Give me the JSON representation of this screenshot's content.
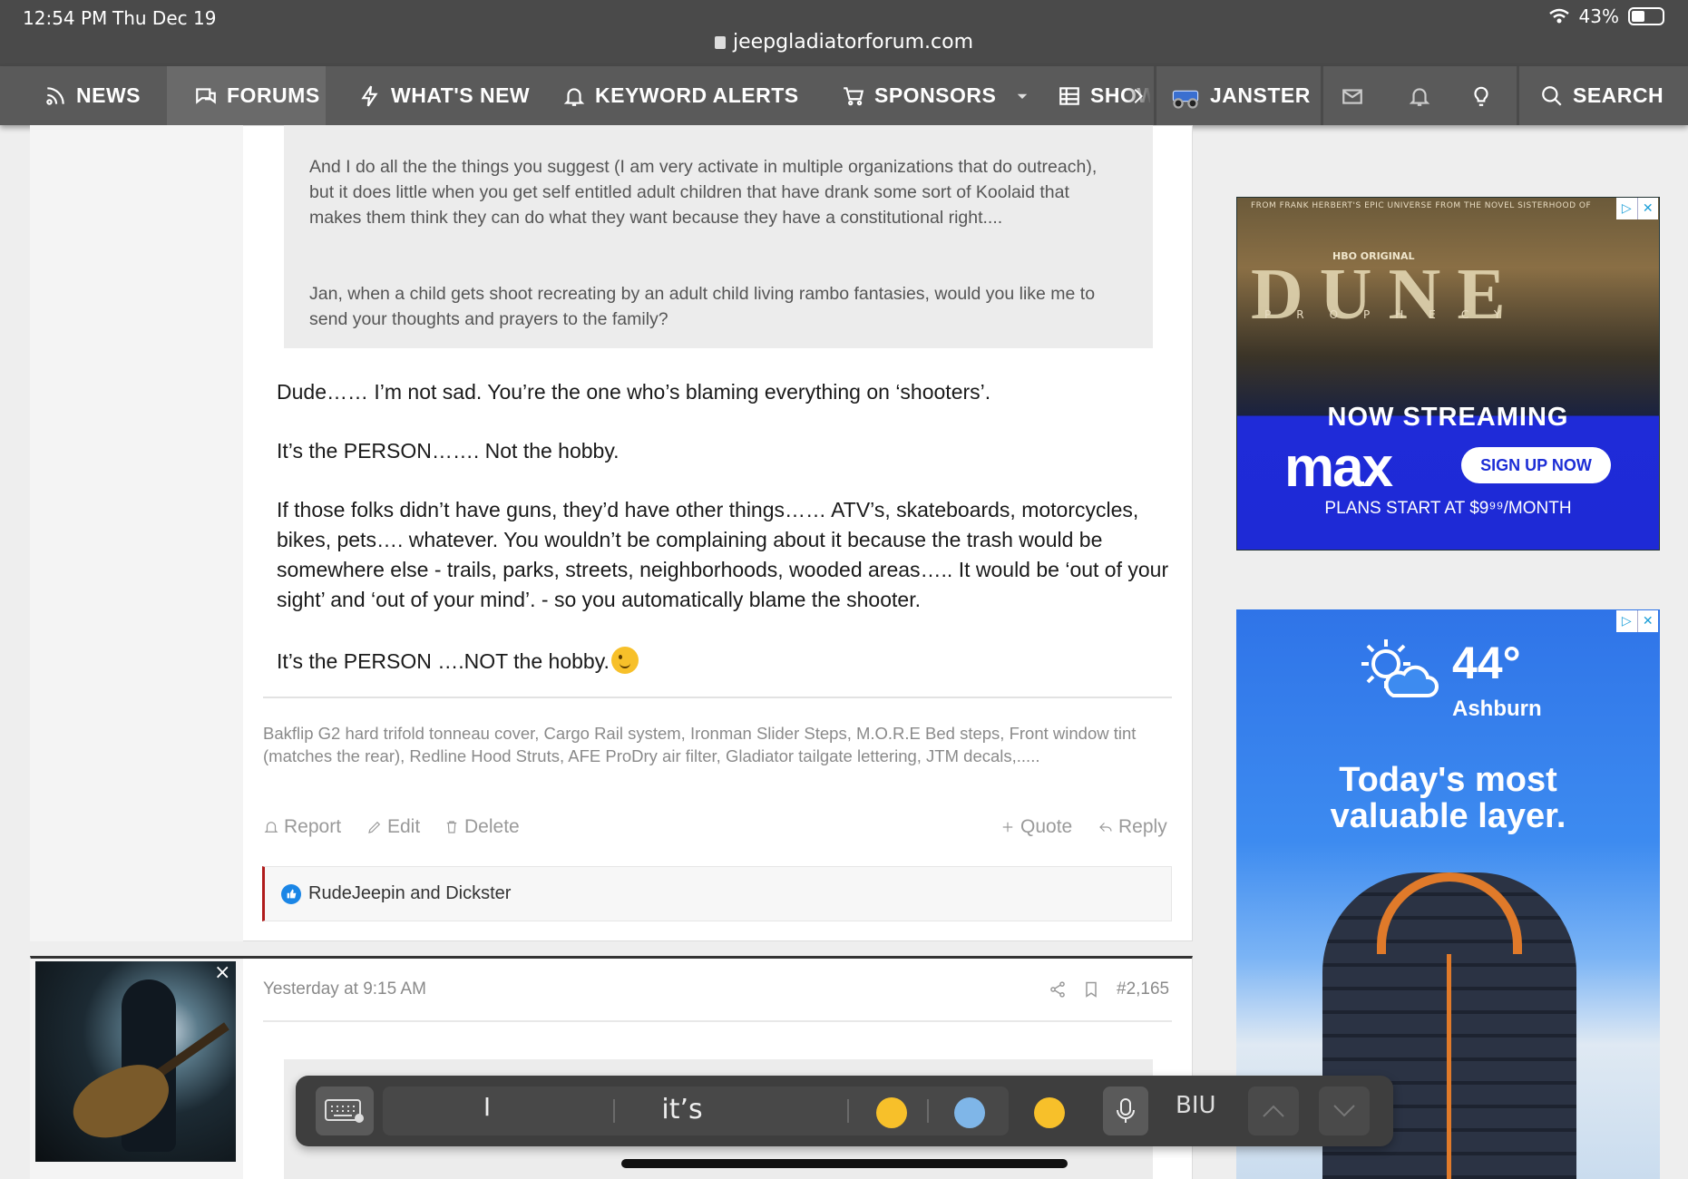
{
  "status": {
    "time": "12:54 PM",
    "date": "Thu Dec 19",
    "battery": "43%"
  },
  "browser": {
    "url": "jeepgladiatorforum.com"
  },
  "nav": {
    "news": "NEWS",
    "forums": "FORUMS",
    "whats_new": "WHAT'S NEW",
    "keyword_alerts": "KEYWORD ALERTS",
    "sponsors": "SPONSORS",
    "show": "SHOW",
    "user": "JANSTER",
    "search": "SEARCH"
  },
  "post": {
    "quote": [
      "And I do all the the things you suggest (I am very activate in multiple organizations that do outreach), but it does little when you get self entitled adult children that have drank some sort of Koolaid that makes them think they can do what they want because they have a constitutional right....",
      "Jan, when a child gets shoot recreating by an adult child living rambo fantasies, would you like me to send your thoughts and prayers to the family?"
    ],
    "body": [
      "Dude…… I’m not sad. You’re the one who’s blaming everything on ‘shooters’.",
      "It’s the PERSON……. Not the hobby.",
      "If those folks didn’t have guns, they’d have other things…… ATV’s, skateboards, motorcycles, bikes, pets…. whatever. You wouldn’t be complaining about it because the trash would be somewhere else - trails, parks, streets, neighborhoods, wooded areas….. It would be ‘out of your sight’ and ‘out of your mind’. - so you automatically blame the shooter.",
      "It’s the PERSON ….NOT the hobby."
    ],
    "signature": "Bakflip G2 hard trifold tonneau cover, Cargo Rail system, Ironman Slider Steps, M.O.R.E Bed steps, Front window tint (matches the rear), Redline Hood Struts, AFE ProDry air filter, Gladiator tailgate lettering, JTM decals,.....",
    "actions": {
      "report": "Report",
      "edit": "Edit",
      "delete": "Delete",
      "quote": "Quote",
      "reply": "Reply"
    },
    "reactions": "RudeJeepin and Dickster"
  },
  "post2": {
    "date": "Yesterday at 9:15 AM",
    "number": "#2,165"
  },
  "ad1": {
    "top_text": "FROM FRANK HERBERT'S EPIC UNIVERSE  FROM THE NOVEL SISTERHOOD OF",
    "hbo": "HBO ORIGINAL",
    "title": "DUNE",
    "subtitle": "PROPHECY",
    "streaming": "NOW STREAMING",
    "brand": "max",
    "button": "SIGN UP NOW",
    "plans": "PLANS START AT $9⁹⁹/MONTH"
  },
  "ad2": {
    "temp": "44°",
    "city": "Ashburn",
    "headline_1": "Today's most",
    "headline_2": "valuable layer."
  },
  "keyboard": {
    "suggestion_1": "I",
    "suggestion_2": "it’s",
    "format": "BIU"
  },
  "colors": {
    "nav_bg": "#5a5a5a",
    "reaction_accent": "#b01c1c",
    "like_blue": "#1b86e6",
    "max_blue": "#1d2ed6"
  }
}
